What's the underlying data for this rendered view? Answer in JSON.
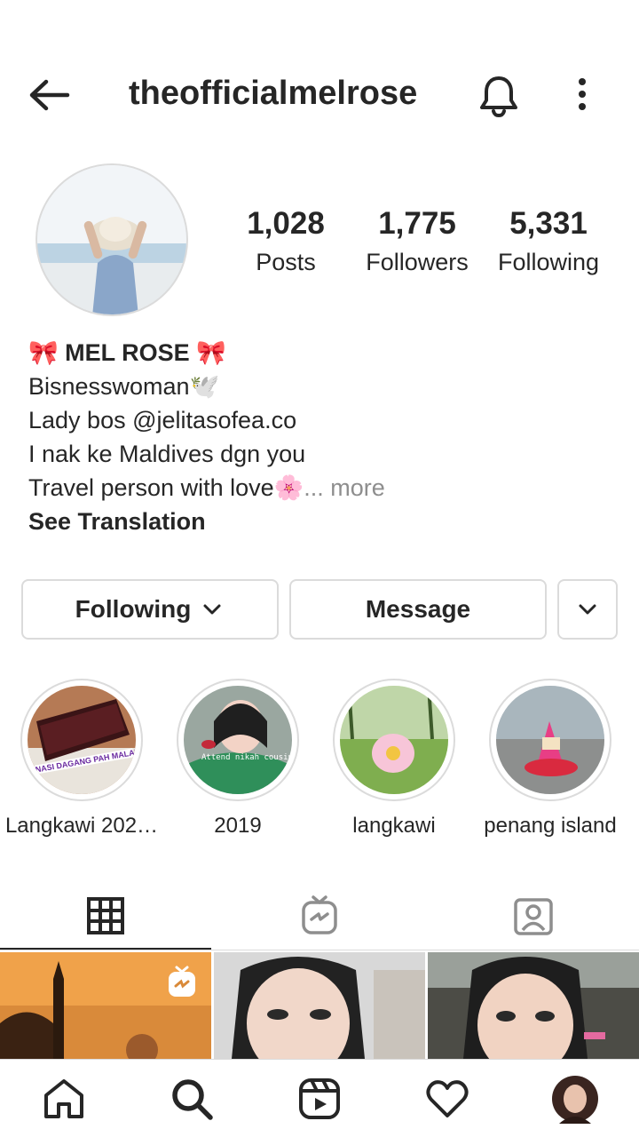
{
  "header": {
    "title": "theofficialmelrose",
    "back_icon": "arrow-left-icon",
    "bell_icon": "bell-icon",
    "more_icon": "more-vertical-icon"
  },
  "profile": {
    "stats": [
      {
        "value": "1,028",
        "label": "Posts"
      },
      {
        "value": "1,775",
        "label": "Followers"
      },
      {
        "value": "5,331",
        "label": "Following"
      }
    ],
    "bio": {
      "name": "🎀 MEL ROSE 🎀",
      "lines": [
        "Bisnesswoman🕊️",
        "Lady bos @jelitasofea.co",
        "I nak ke Maldives dgn you",
        "Travel person with love🌸"
      ],
      "more": "... more",
      "translate": "See Translation"
    }
  },
  "actions": {
    "following": "Following",
    "message": "Message"
  },
  "highlights": [
    {
      "label": "Langkawi 202…",
      "caption": "NASI DAGANG PAH MALAU"
    },
    {
      "label": "2019",
      "caption": "Attend nikah cousin"
    },
    {
      "label": "langkawi"
    },
    {
      "label": "penang island"
    }
  ],
  "colors": {
    "text": "#262626",
    "muted": "#8e8e8e",
    "border": "#dbdbdb"
  }
}
